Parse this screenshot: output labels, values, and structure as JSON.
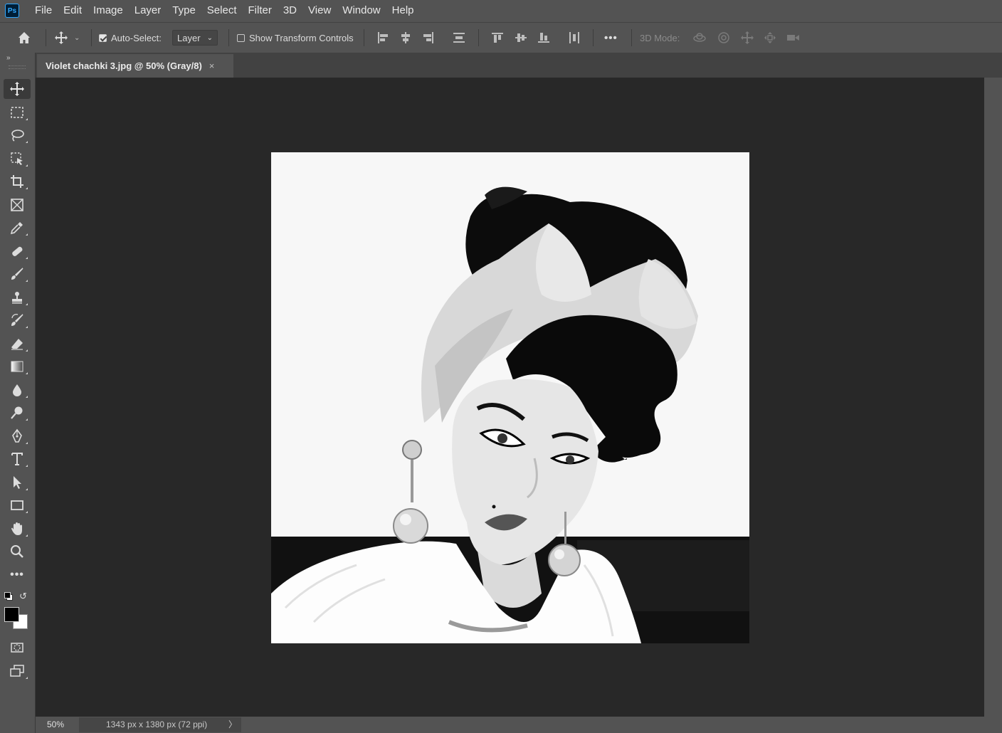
{
  "app": {
    "logo_text": "Ps"
  },
  "menu": [
    "File",
    "Edit",
    "Image",
    "Layer",
    "Type",
    "Select",
    "Filter",
    "3D",
    "View",
    "Window",
    "Help"
  ],
  "options_bar": {
    "auto_select_label": "Auto-Select:",
    "auto_select_checked": true,
    "auto_select_target": "Layer",
    "show_transform_label": "Show Transform Controls",
    "show_transform_checked": false,
    "more_label": "•••",
    "mode_3d_label": "3D Mode:"
  },
  "tools": [
    "move-tool",
    "rectangular-marquee-tool",
    "lasso-tool",
    "object-selection-tool",
    "crop-tool",
    "frame-tool",
    "eyedropper-tool",
    "healing-brush-tool",
    "brush-tool",
    "clone-stamp-tool",
    "history-brush-tool",
    "eraser-tool",
    "gradient-tool",
    "blur-tool",
    "dodge-tool",
    "pen-tool",
    "type-tool",
    "path-selection-tool",
    "rectangle-tool",
    "hand-tool",
    "zoom-tool",
    "edit-toolbar"
  ],
  "tools_more": "•••",
  "colors": {
    "foreground": "#000000",
    "background": "#ffffff"
  },
  "document": {
    "tab_title": "Violet chachki 3.jpg @ 50% (Gray/8)",
    "close_symbol": "×"
  },
  "status": {
    "zoom": "50%",
    "doc_info": "1343 px x 1380 px (72 ppi)",
    "arrow": "〉"
  }
}
